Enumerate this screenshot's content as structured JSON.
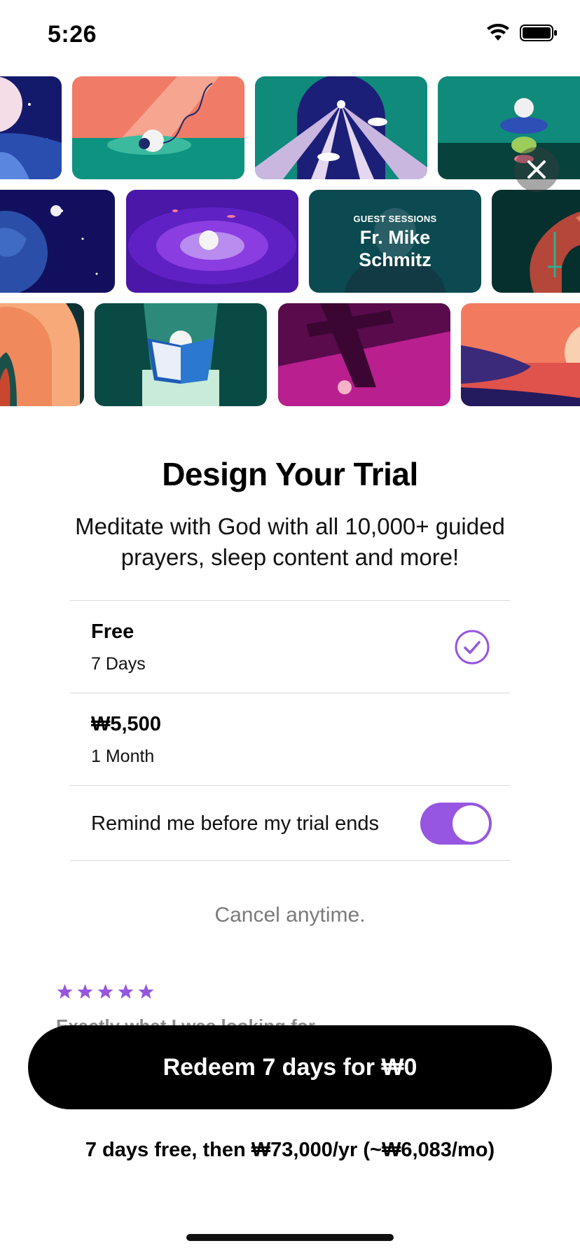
{
  "status_bar": {
    "time": "5:26"
  },
  "gallery": {
    "guest_session": {
      "eyebrow": "GUEST SESSIONS",
      "name_line1": "Fr. Mike",
      "name_line2": "Schmitz"
    }
  },
  "paywall": {
    "title": "Design Your Trial",
    "subtitle": "Meditate with God with all 10,000+ guided prayers, sleep content and more!",
    "options": [
      {
        "title": "Free",
        "duration": "7 Days",
        "selected": true
      },
      {
        "title": "₩5,500",
        "duration": "1 Month",
        "selected": false
      }
    ],
    "reminder": {
      "label": "Remind me before my trial ends",
      "enabled": true
    },
    "cancel_note": "Cancel anytime.",
    "review": {
      "rating": 5,
      "title_peek": "Exactly what I was looking for"
    },
    "cta_label": "Redeem 7 days for ₩0",
    "price_note": "7 days free, then ₩73,000/yr (~₩6,083/mo)"
  },
  "colors": {
    "accent": "#9656e0",
    "cta": "#000000",
    "muted": "#7a7a7a"
  }
}
